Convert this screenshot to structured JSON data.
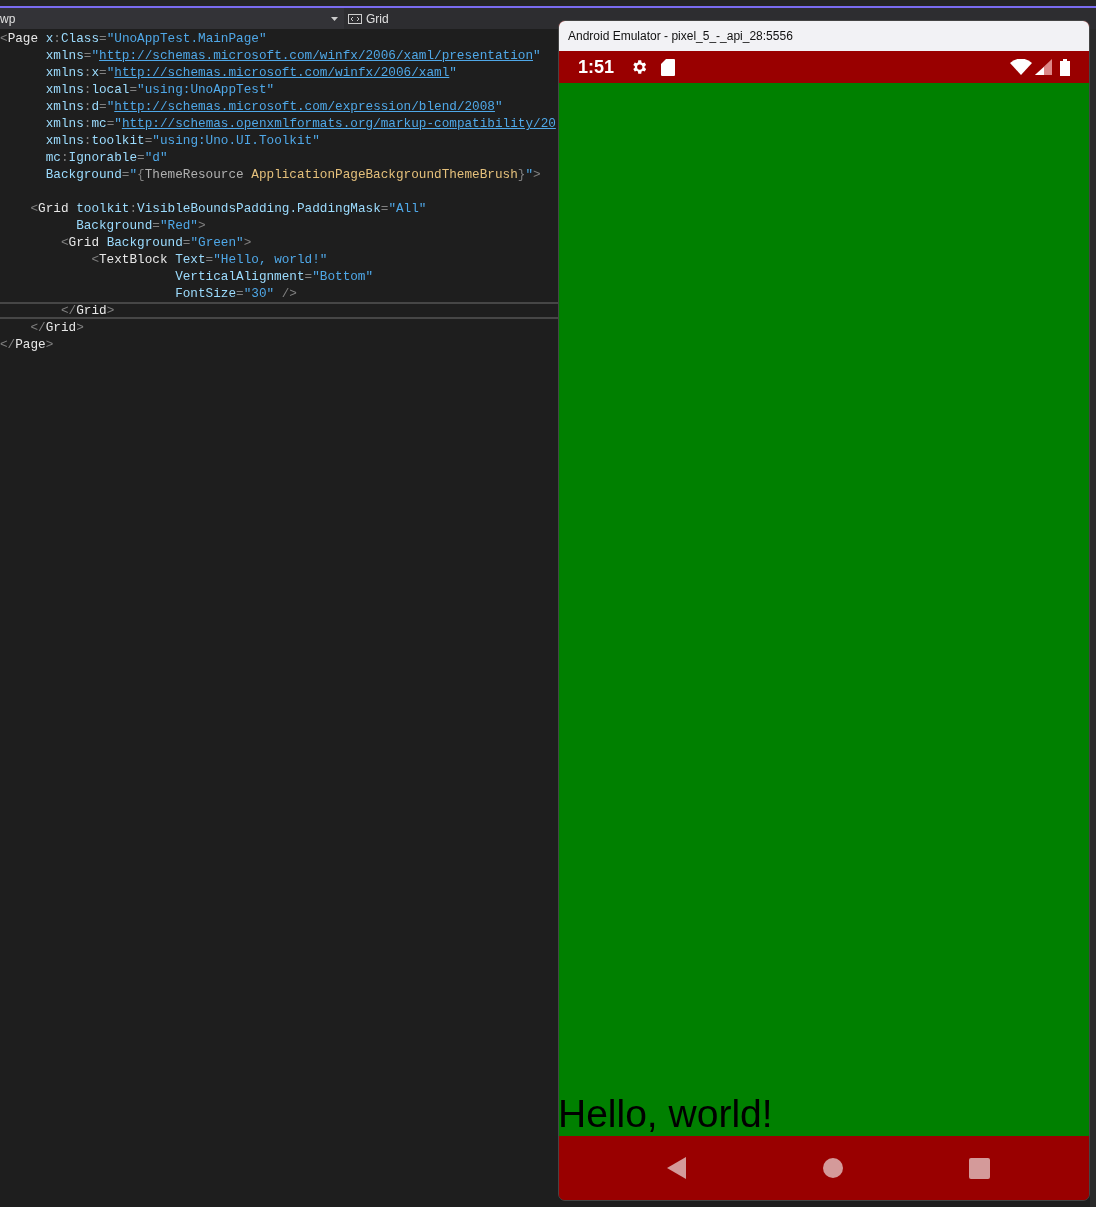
{
  "editor": {
    "navigation": {
      "scope": "wp",
      "element": "Grid"
    },
    "lines": [
      {
        "kind": "code",
        "current": false,
        "tokens": [
          {
            "kind": "punct",
            "text": "<"
          },
          {
            "kind": "tag",
            "text": "Page"
          },
          {
            "kind": "attr",
            "text": " x"
          },
          {
            "kind": "punct",
            "text": ":"
          },
          {
            "kind": "attr",
            "text": "Class"
          },
          {
            "kind": "punct",
            "text": "="
          },
          {
            "kind": "value",
            "text": "\"UnoAppTest.MainPage\""
          }
        ]
      },
      {
        "kind": "code",
        "current": false,
        "tokens": [
          {
            "kind": "attr",
            "text": "      xmlns"
          },
          {
            "kind": "punct",
            "text": "="
          },
          {
            "kind": "value",
            "text": "\""
          },
          {
            "kind": "link",
            "text": "http://schemas.microsoft.com/winfx/2006/xaml/presentation"
          },
          {
            "kind": "value",
            "text": "\""
          }
        ]
      },
      {
        "kind": "code",
        "current": false,
        "tokens": [
          {
            "kind": "attr",
            "text": "      xmlns"
          },
          {
            "kind": "punct",
            "text": ":"
          },
          {
            "kind": "attr",
            "text": "x"
          },
          {
            "kind": "punct",
            "text": "="
          },
          {
            "kind": "value",
            "text": "\""
          },
          {
            "kind": "link",
            "text": "http://schemas.microsoft.com/winfx/2006/xaml"
          },
          {
            "kind": "value",
            "text": "\""
          }
        ]
      },
      {
        "kind": "code",
        "current": false,
        "tokens": [
          {
            "kind": "attr",
            "text": "      xmlns"
          },
          {
            "kind": "punct",
            "text": ":"
          },
          {
            "kind": "attr",
            "text": "local"
          },
          {
            "kind": "punct",
            "text": "="
          },
          {
            "kind": "value",
            "text": "\"using:UnoAppTest\""
          }
        ]
      },
      {
        "kind": "code",
        "current": false,
        "tokens": [
          {
            "kind": "attr",
            "text": "      xmlns"
          },
          {
            "kind": "punct",
            "text": ":"
          },
          {
            "kind": "attr",
            "text": "d"
          },
          {
            "kind": "punct",
            "text": "="
          },
          {
            "kind": "value",
            "text": "\""
          },
          {
            "kind": "link",
            "text": "http://schemas.microsoft.com/expression/blend/2008"
          },
          {
            "kind": "value",
            "text": "\""
          }
        ]
      },
      {
        "kind": "code",
        "current": false,
        "tokens": [
          {
            "kind": "attr",
            "text": "      xmlns"
          },
          {
            "kind": "punct",
            "text": ":"
          },
          {
            "kind": "attr",
            "text": "mc"
          },
          {
            "kind": "punct",
            "text": "="
          },
          {
            "kind": "value",
            "text": "\""
          },
          {
            "kind": "link",
            "text": "http://schemas.openxmlformats.org/markup-compatibility/20"
          }
        ]
      },
      {
        "kind": "code",
        "current": false,
        "tokens": [
          {
            "kind": "attr",
            "text": "      xmlns"
          },
          {
            "kind": "punct",
            "text": ":"
          },
          {
            "kind": "attr",
            "text": "toolkit"
          },
          {
            "kind": "punct",
            "text": "="
          },
          {
            "kind": "value",
            "text": "\"using:Uno.UI.Toolkit\""
          }
        ]
      },
      {
        "kind": "code",
        "current": false,
        "tokens": [
          {
            "kind": "attr",
            "text": "      mc"
          },
          {
            "kind": "punct",
            "text": ":"
          },
          {
            "kind": "attr",
            "text": "Ignorable"
          },
          {
            "kind": "punct",
            "text": "="
          },
          {
            "kind": "value",
            "text": "\"d\""
          }
        ]
      },
      {
        "kind": "code",
        "current": false,
        "tokens": [
          {
            "kind": "attr",
            "text": "      Background"
          },
          {
            "kind": "punct",
            "text": "="
          },
          {
            "kind": "value",
            "text": "\""
          },
          {
            "kind": "punct",
            "text": "{"
          },
          {
            "kind": "markup",
            "text": "ThemeResource"
          },
          {
            "kind": "resource",
            "text": " ApplicationPageBackgroundThemeBrush"
          },
          {
            "kind": "punct",
            "text": "}"
          },
          {
            "kind": "value",
            "text": "\""
          },
          {
            "kind": "punct",
            "text": ">"
          }
        ]
      },
      {
        "kind": "blank",
        "current": false
      },
      {
        "kind": "code",
        "current": false,
        "tokens": [
          {
            "kind": "punct",
            "text": "    <"
          },
          {
            "kind": "tag",
            "text": "Grid"
          },
          {
            "kind": "attr",
            "text": " toolkit"
          },
          {
            "kind": "punct",
            "text": ":"
          },
          {
            "kind": "attr",
            "text": "VisibleBoundsPadding.PaddingMask"
          },
          {
            "kind": "punct",
            "text": "="
          },
          {
            "kind": "value",
            "text": "\"All\""
          }
        ]
      },
      {
        "kind": "code",
        "current": false,
        "tokens": [
          {
            "kind": "attr",
            "text": "          Background"
          },
          {
            "kind": "punct",
            "text": "="
          },
          {
            "kind": "value",
            "text": "\"Red\""
          },
          {
            "kind": "punct",
            "text": ">"
          }
        ]
      },
      {
        "kind": "code",
        "current": false,
        "tokens": [
          {
            "kind": "punct",
            "text": "        <"
          },
          {
            "kind": "tag",
            "text": "Grid"
          },
          {
            "kind": "attr",
            "text": " Background"
          },
          {
            "kind": "punct",
            "text": "="
          },
          {
            "kind": "value",
            "text": "\"Green\""
          },
          {
            "kind": "punct",
            "text": ">"
          }
        ]
      },
      {
        "kind": "code",
        "current": false,
        "tokens": [
          {
            "kind": "punct",
            "text": "            <"
          },
          {
            "kind": "tag",
            "text": "TextBlock"
          },
          {
            "kind": "attr",
            "text": " Text"
          },
          {
            "kind": "punct",
            "text": "="
          },
          {
            "kind": "value",
            "text": "\"Hello, world!\""
          }
        ]
      },
      {
        "kind": "code",
        "current": false,
        "tokens": [
          {
            "kind": "attr",
            "text": "                       VerticalAlignment"
          },
          {
            "kind": "punct",
            "text": "="
          },
          {
            "kind": "value",
            "text": "\"Bottom\""
          }
        ]
      },
      {
        "kind": "code",
        "current": false,
        "tokens": [
          {
            "kind": "attr",
            "text": "                       FontSize"
          },
          {
            "kind": "punct",
            "text": "="
          },
          {
            "kind": "value",
            "text": "\"30\""
          },
          {
            "kind": "punct",
            "text": " />"
          }
        ]
      },
      {
        "kind": "code",
        "current": true,
        "tokens": [
          {
            "kind": "punct",
            "text": "        </"
          },
          {
            "kind": "tag",
            "text": "Grid"
          },
          {
            "kind": "punct",
            "text": ">"
          }
        ]
      },
      {
        "kind": "code",
        "current": false,
        "tokens": [
          {
            "kind": "punct",
            "text": "    </"
          },
          {
            "kind": "tag",
            "text": "Grid"
          },
          {
            "kind": "punct",
            "text": ">"
          }
        ]
      },
      {
        "kind": "code",
        "current": false,
        "tokens": [
          {
            "kind": "punct",
            "text": "</"
          },
          {
            "kind": "tag",
            "text": "Page"
          },
          {
            "kind": "punct",
            "text": ">"
          }
        ]
      }
    ]
  },
  "emulator": {
    "title": "Android Emulator - pixel_5_-_api_28:5556",
    "status_bar": {
      "time": "1:51"
    },
    "app": {
      "text": "Hello, world!"
    }
  }
}
